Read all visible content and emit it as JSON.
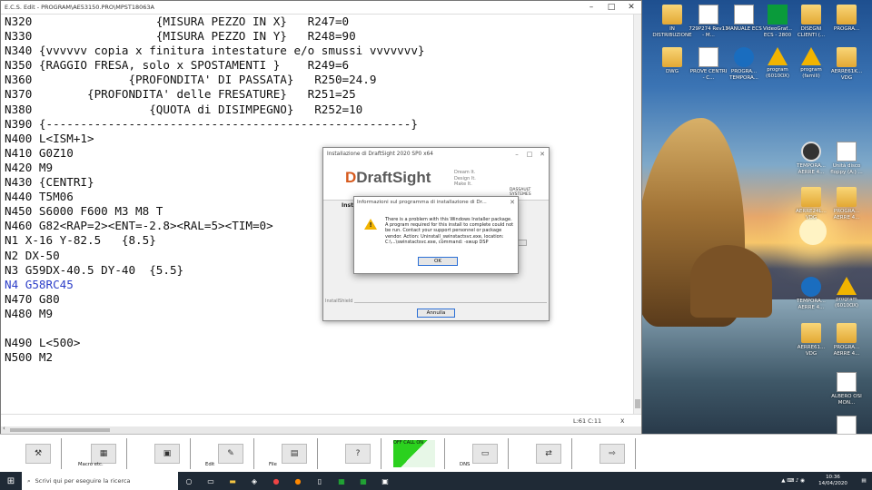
{
  "editor": {
    "title": "E.C.S. Edit - PROGRAM\\AE53150.PRO\\MPST18063A",
    "lines": [
      {
        "text": "N320                  {MISURA PEZZO IN X}   R247=0"
      },
      {
        "text": "N330                  {MISURA PEZZO IN Y}   R248=90"
      },
      {
        "text": "N340 {vvvvvv copia x finitura intestature e/o smussi vvvvvvv}"
      },
      {
        "text": "N350 {RAGGIO FRESA, solo x SPOSTAMENTI }    R249=6"
      },
      {
        "text": "N360              {PROFONDITA' DI PASSATA}   R250=24.9"
      },
      {
        "text": "N370        {PROFONDITA' delle FRESATURE}   R251=25"
      },
      {
        "text": "N380                 {QUOTA di DISIMPEGNO}   R252=10"
      },
      {
        "text": "N390 {-----------------------------------------------------}"
      },
      {
        "text": "N400 L<ISM+1>"
      },
      {
        "text": "N410 G0Z10"
      },
      {
        "text": "N420 M9"
      },
      {
        "text": "N430 {CENTRI}"
      },
      {
        "text": "N440 T5M06"
      },
      {
        "text": "N450 S6000 F600 M3 M8 T"
      },
      {
        "text": "N460 G82<RAP=2><ENT=-2.8><RAL=5><TIM=0>"
      },
      {
        "text": "N1 X-16 Y-82.5   {8.5}"
      },
      {
        "text": "N2 DX-50"
      },
      {
        "text": "N3 G59DX-40.5 DY-40  {5.5}"
      },
      {
        "text": "N4 G58RC45",
        "highlight": true
      },
      {
        "text": "N470 G80"
      },
      {
        "text": "N480 M9"
      },
      {
        "text": ""
      },
      {
        "text": "N490 L<500>"
      },
      {
        "text": "N500 M2"
      }
    ],
    "status_pos": "L:61 C:11",
    "status_close": "X"
  },
  "installer": {
    "title": "Installazione di DraftSight 2020 SP0 x64",
    "logo": "DraftSight",
    "tagline": "Dream It.\nDesign It.\nMake It.",
    "vendor": "DASSAULT SYSTEMES",
    "status_text": "Insta",
    "installshield": "InstallShield",
    "cancel_label": "Annulla"
  },
  "info_dialog": {
    "title": "Informazioni sul programma di installazione di Dr...",
    "message": "There is a problem with this Windows Installer package. A program required for this install to complete could not be run. Contact your support personnel or package vendor. Action: Uninstall_swinstactsvc.exe, location: C:\\...\\swinstactsvc.exe, command: -swup DSP",
    "ok_label": "OK"
  },
  "desktop_icons": [
    {
      "label": "IN DISTRIBUZIONE",
      "kind": "folder"
    },
    {
      "label": "729P274 Rev11 - M...",
      "kind": "doc"
    },
    {
      "label": "MANUALE ECS",
      "kind": "doc"
    },
    {
      "label": "VideoGraf... ECS - 2800",
      "kind": "ecs"
    },
    {
      "label": "DISEGNI CLIENTI (...",
      "kind": "folder"
    },
    {
      "label": "PROGRA...",
      "kind": "folder"
    },
    {
      "label": "DWG",
      "kind": "folder"
    },
    {
      "label": "PROVE CENTRI - C...",
      "kind": "doc"
    },
    {
      "label": "PROGRA... TEMPORA...",
      "kind": "blue"
    },
    {
      "label": "program (6010OX)",
      "kind": "warn"
    },
    {
      "label": "program (famili)",
      "kind": "warn"
    },
    {
      "label": "AERRE61K... VDG",
      "kind": "folder"
    },
    {
      "label": "TEMPORA... AERRE 4...",
      "kind": "clock"
    },
    {
      "label": "Unità disco floppy (A:) ...",
      "kind": "doc"
    },
    {
      "label": "AERRE24L... VDG",
      "kind": "folder"
    },
    {
      "label": "PROGRA... AERRE 4...",
      "kind": "folder"
    },
    {
      "label": "TEMPORA... AERRE 4...",
      "kind": "blue"
    },
    {
      "label": "program (6010OX)",
      "kind": "warn"
    },
    {
      "label": "AERRE61... VDG",
      "kind": "folder"
    },
    {
      "label": "PROGRA... AERRE 4...",
      "kind": "folder"
    },
    {
      "label": "ALBERO OSI MON...",
      "kind": "doc"
    },
    {
      "label": "",
      "kind": "doc"
    }
  ],
  "ecs_toolbar": [
    {
      "label": "",
      "icon": "⚒"
    },
    {
      "label": "Macro etc.",
      "icon": "▦"
    },
    {
      "label": "",
      "icon": "▣"
    },
    {
      "label": "Edit",
      "icon": "✎"
    },
    {
      "label": "File",
      "icon": "▤"
    },
    {
      "label": "",
      "icon": "?"
    },
    {
      "label": "OFF  CALL  ON",
      "icon": ""
    },
    {
      "label": "DNS",
      "icon": "▭"
    },
    {
      "label": "",
      "icon": "⇄"
    },
    {
      "label": "",
      "icon": "⇨"
    }
  ],
  "taskbar": {
    "search_placeholder": "Scrivi qui per eseguire la ricerca",
    "time": "10:36",
    "date": "14/04/2020"
  }
}
